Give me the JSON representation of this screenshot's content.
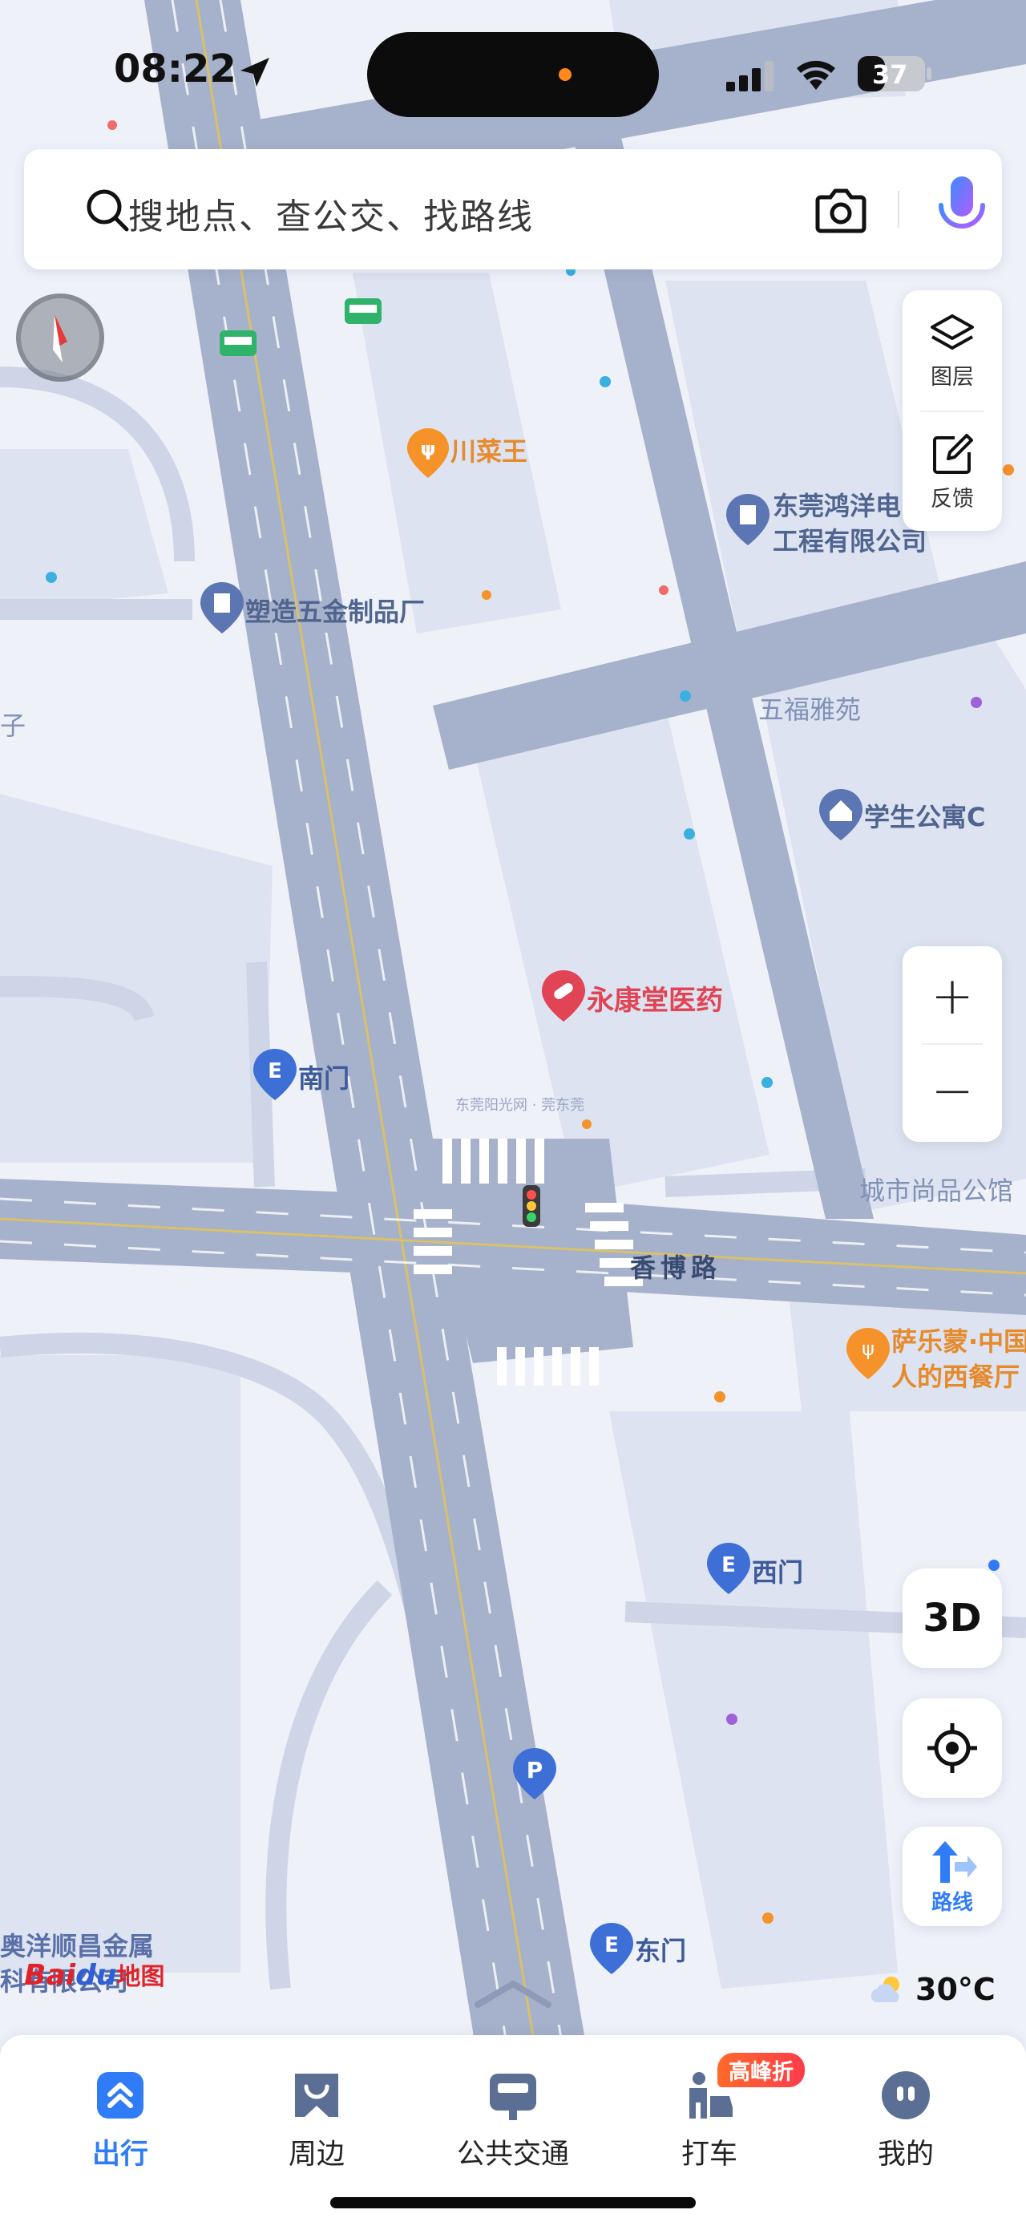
{
  "status_bar": {
    "time": "08:22",
    "battery": "37"
  },
  "search": {
    "placeholder": "搜地点、查公交、找路线"
  },
  "side_panel": {
    "layers_label": "图层",
    "feedback_label": "反馈"
  },
  "zoom": {
    "in_label": "+",
    "out_label": "−"
  },
  "map_controls": {
    "three_d_label": "3D",
    "route_label": "路线"
  },
  "weather": {
    "temperature": "30°C"
  },
  "logo": {
    "brand": "Bai",
    "paw": "du",
    "suffix": "地图"
  },
  "map": {
    "pois": {
      "chuancaiwang": "川菜王",
      "dongguan_hongyang_line1": "东莞鸿洋电",
      "dongguan_hongyang_line2": "工程有限公司",
      "suzao": "塑造五金制品厂",
      "wufu": "五福雅苑",
      "xuesheng": "学生公寓C",
      "yongkangtang": "永康堂医药",
      "nanmen": "南门",
      "chengshi": "城市尚品公馆",
      "xiangbo_road": "香博路",
      "salemeng_line1": "萨乐蒙·中国",
      "salemeng_line2": "人的西餐厅",
      "ximen": "西门",
      "dongmen": "东门",
      "aoyang_line1": "奥洋顺昌金属",
      "aoyang_line2": "科有限公司",
      "left_edge": "子",
      "watermark": "东莞阳光网 · 莞东莞"
    }
  },
  "bottom_nav": {
    "items": [
      {
        "label": "出行",
        "active": true
      },
      {
        "label": "周边",
        "active": false
      },
      {
        "label": "公共交通",
        "active": false
      },
      {
        "label": "打车",
        "active": false,
        "badge": "高峰折"
      },
      {
        "label": "我的",
        "active": false
      }
    ]
  },
  "colors": {
    "accent": "#2f7cf6",
    "road": "#a6b1cb",
    "block": "#dde3f0",
    "background": "#eef1f8"
  }
}
